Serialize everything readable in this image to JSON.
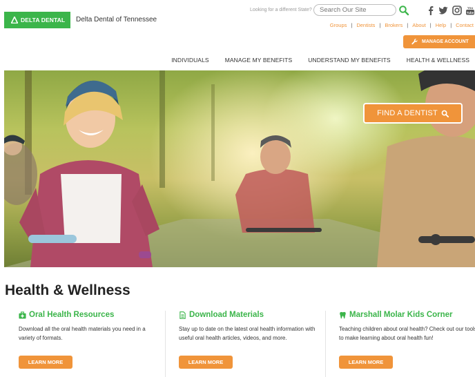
{
  "brand": {
    "logo_text": "DELTA DENTAL",
    "subtitle": "Delta Dental of Tennessee",
    "logo_color": "#3bb54a"
  },
  "header": {
    "state_question": "Looking for a different State?",
    "search_placeholder": "Search Our Site",
    "social_icons": [
      "facebook-icon",
      "twitter-icon",
      "instagram-icon",
      "youtube-icon"
    ],
    "util_links": [
      "Groups",
      "Dentists",
      "Brokers",
      "About",
      "Help",
      "Contact"
    ],
    "manage_account": "MANAGE ACCOUNT",
    "accent_color": "#f0943a"
  },
  "nav": {
    "items": [
      "INDIVIDUALS",
      "MANAGE MY BENEFITS",
      "UNDERSTAND MY BENEFITS",
      "HEALTH & WELLNESS"
    ]
  },
  "hero": {
    "find_dentist": "FIND A DENTIST"
  },
  "section": {
    "title": "Health & Wellness",
    "columns": [
      {
        "heading": "Oral Health Resources",
        "icon": "medkit-icon",
        "description": "Download all the oral health materials you need in a variety of formats.",
        "button": "LEARN MORE"
      },
      {
        "heading": "Download Materials",
        "icon": "document-icon",
        "description": "Stay up to date on the latest oral health information with useful oral health articles, videos, and more.",
        "button": "LEARN MORE"
      },
      {
        "heading": "Marshall Molar Kids Corner",
        "icon": "tooth-icon",
        "description": "Teaching children about oral health? Check out our tools to make learning about oral health fun!",
        "button": "LEARN MORE"
      }
    ]
  }
}
